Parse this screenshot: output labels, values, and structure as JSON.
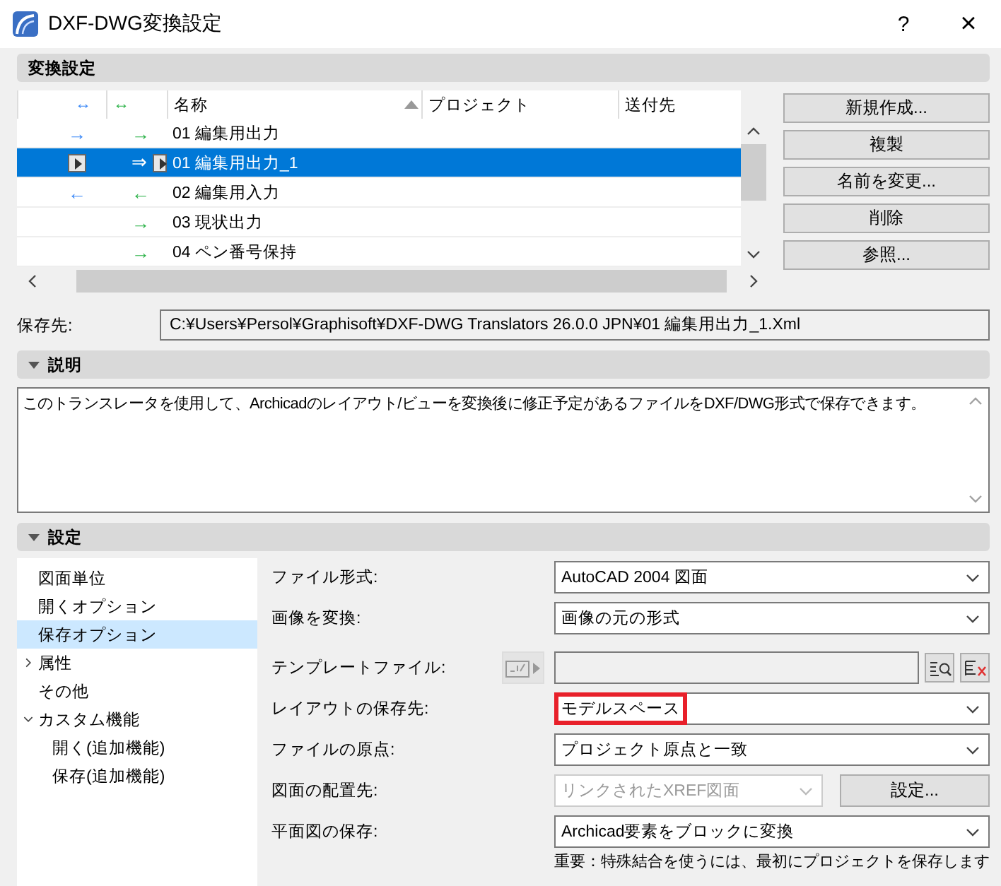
{
  "window": {
    "title": "DXF-DWG変換設定",
    "help": "?",
    "close": "×"
  },
  "translators": {
    "header": "変換設定",
    "columns": [
      {
        "label": "↔"
      },
      {
        "label": "↔"
      },
      {
        "label": "名称",
        "sorted": true
      },
      {
        "label": "プロジェクト"
      },
      {
        "label": "送付先"
      }
    ],
    "rows": [
      {
        "open": "→",
        "save": "→",
        "name": "01 編集用出力",
        "selected": false,
        "buttons": false
      },
      {
        "open": "",
        "save": "⇒",
        "name": "01 編集用出力_1",
        "selected": true,
        "buttons": true
      },
      {
        "open": "←",
        "save": "←",
        "name": "02 編集用入力",
        "selected": false,
        "buttons": false
      },
      {
        "open": "",
        "save": "→",
        "name": "03 現状出力",
        "selected": false,
        "buttons": false
      },
      {
        "open": "",
        "save": "→",
        "name": "04 ペン番号保持",
        "selected": false,
        "buttons": false
      }
    ],
    "actions": [
      "新規作成...",
      "複製",
      "名前を変更...",
      "削除",
      "参照..."
    ]
  },
  "save_location": {
    "label": "保存先:",
    "value": "C:¥Users¥Persol¥Graphisoft¥DXF-DWG Translators 26.0.0 JPN¥01 編集用出力_1.Xml"
  },
  "description": {
    "header": "説明",
    "expanded": true,
    "text": "このトランスレータを使用して、Archicadのレイアウト/ビューを変換後に修正予定があるファイルをDXF/DWG形式で保存できます。"
  },
  "settings": {
    "header": "設定",
    "expanded": true,
    "tree": [
      {
        "label": "図面単位",
        "selected": false
      },
      {
        "label": "開くオプション",
        "selected": false
      },
      {
        "label": "保存オプション",
        "selected": true
      },
      {
        "label": "属性",
        "selected": false,
        "expanded": false
      },
      {
        "label": "その他",
        "selected": false
      },
      {
        "label": "カスタム機能",
        "selected": false,
        "expanded": true,
        "children": [
          {
            "label": "開く(追加機能)",
            "selected": false
          },
          {
            "label": "保存(追加機能)",
            "selected": false
          }
        ]
      }
    ],
    "fields": [
      {
        "kind": "select",
        "label": "ファイル形式:",
        "value": "AutoCAD 2004 図面",
        "disabled": false
      },
      {
        "kind": "select",
        "label": "画像を変換:",
        "value": "画像の元の形式",
        "disabled": false
      },
      {
        "kind": "file",
        "label": "テンプレートファイル:",
        "disabled": true
      },
      {
        "kind": "select",
        "label": "レイアウトの保存先:",
        "value": "モデルスペース",
        "disabled": false,
        "highlighted": true
      },
      {
        "kind": "select",
        "label": "ファイルの原点:",
        "value": "プロジェクト原点と一致",
        "disabled": false
      },
      {
        "kind": "select",
        "label": "図面の配置先:",
        "value": "リンクされたXREF図面",
        "disabled": true,
        "button": "設定..."
      },
      {
        "kind": "select",
        "label": "平面図の保存:",
        "value": "Archicad要素をブロックに変換",
        "disabled": false
      }
    ],
    "note": "重要：特殊結合を使うには、最初にプロジェクトを保存します"
  }
}
